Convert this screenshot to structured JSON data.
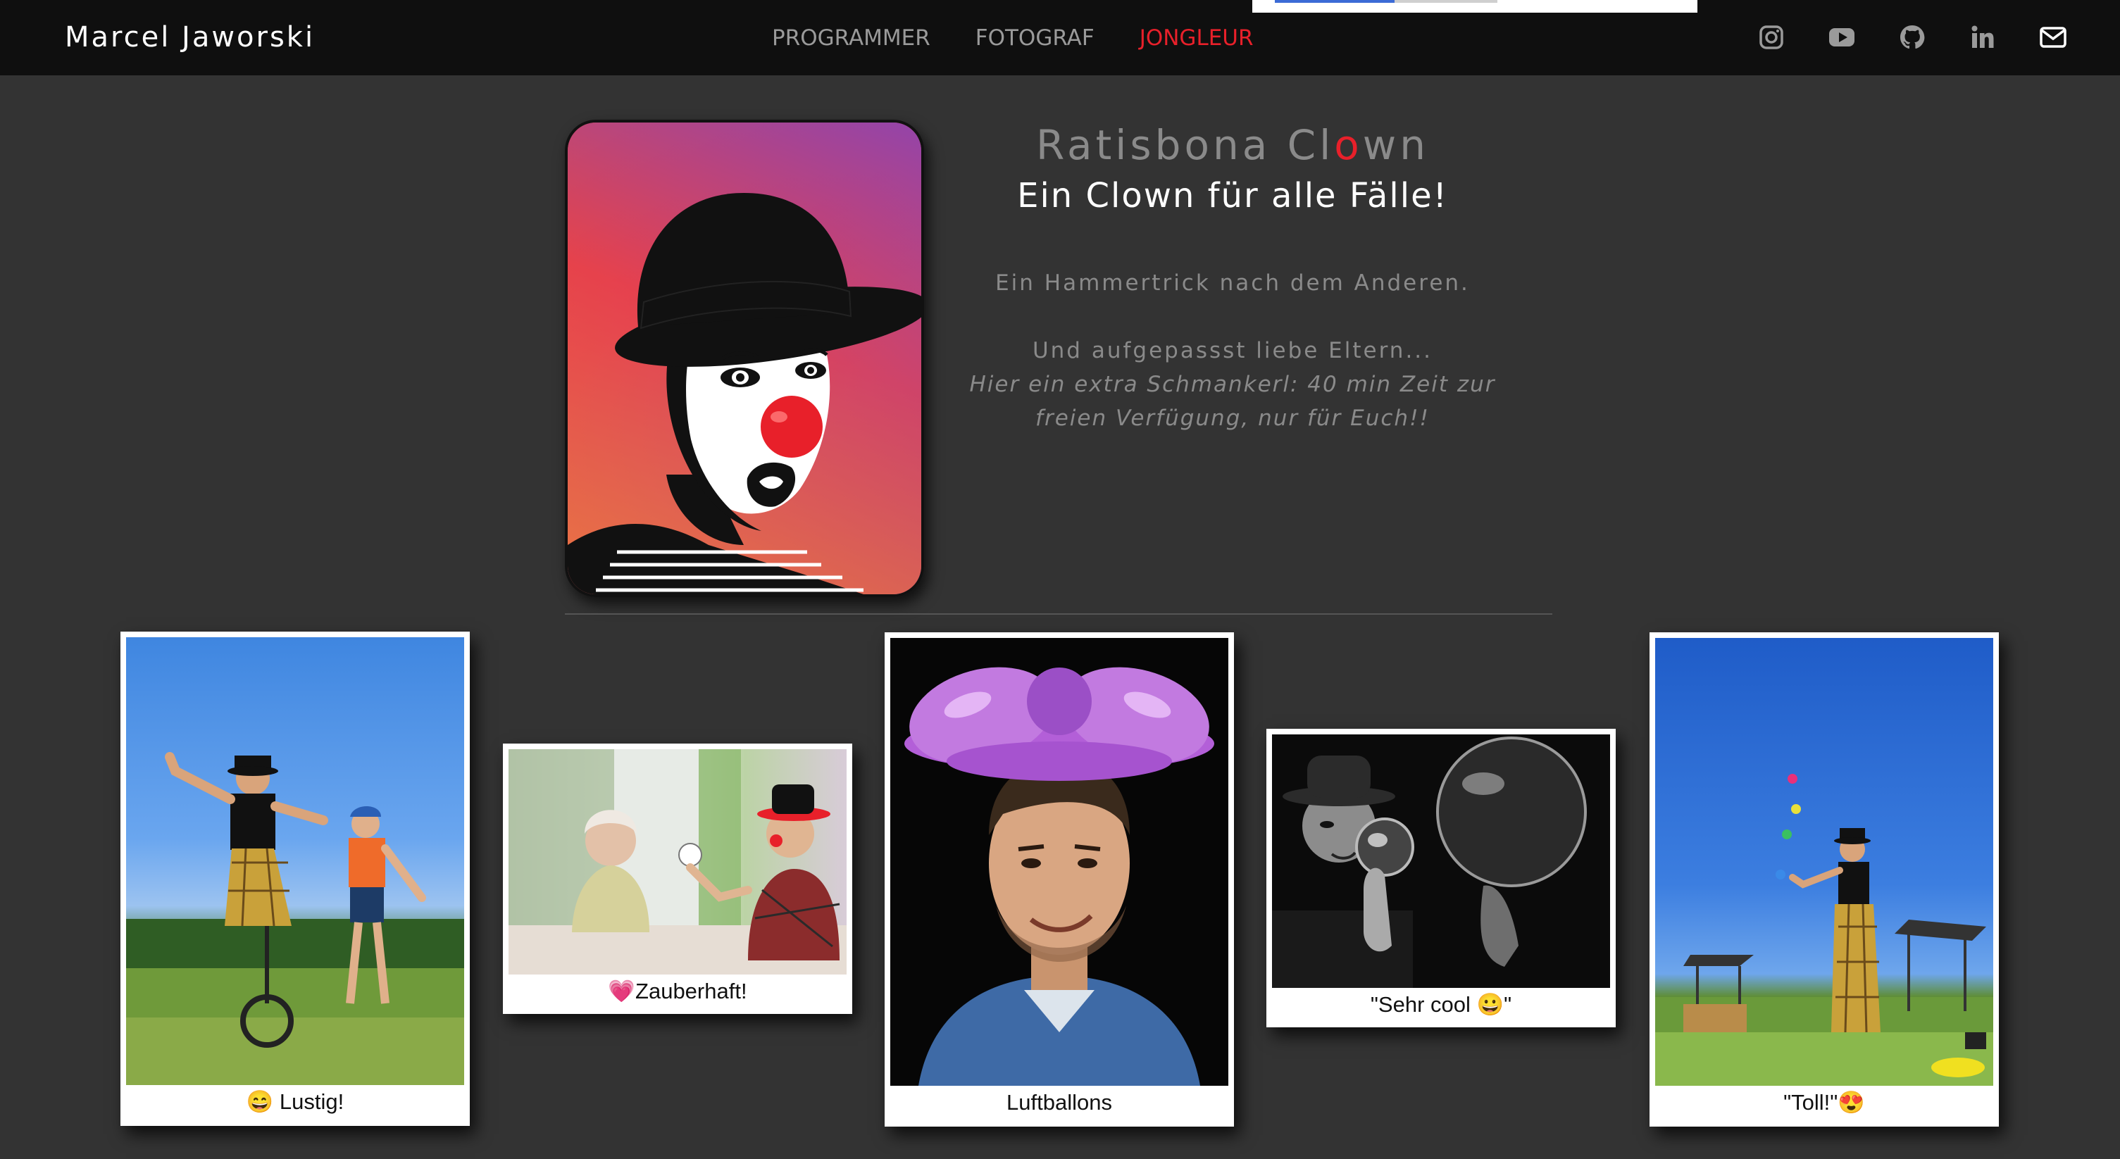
{
  "navbar": {
    "brand": "Marcel Jaworski",
    "links": [
      {
        "label": "PROGRAMMER",
        "active": false
      },
      {
        "label": "FOTOGRAF",
        "active": false
      },
      {
        "label": "JONGLEUR",
        "active": true
      }
    ],
    "social_icons": [
      "instagram-icon",
      "youtube-icon",
      "github-icon",
      "linkedin-icon",
      "mail-icon"
    ]
  },
  "hero": {
    "title_part1": "Ratisbona Cl",
    "title_red": "o",
    "title_part2": "wn",
    "subtitle": "Ein Clown für alle Fälle!",
    "line1": "Ein Hammertrick nach dem Anderen.",
    "line2": "Und aufgepassst liebe Eltern...",
    "line3": "Hier ein extra Schmankerl: 40 min Zeit zur freien Verfügung, nur für Euch!!"
  },
  "gallery": [
    {
      "caption": "😄 Lustig!"
    },
    {
      "caption": "💗Zauberhaft!"
    },
    {
      "caption": "Luftballons"
    },
    {
      "caption": "\"Sehr cool 😀\""
    },
    {
      "caption": "\"Toll!\"😍"
    }
  ],
  "colors": {
    "accent": "#e8202a",
    "background": "#333333",
    "navbar": "#0f0f0f"
  }
}
